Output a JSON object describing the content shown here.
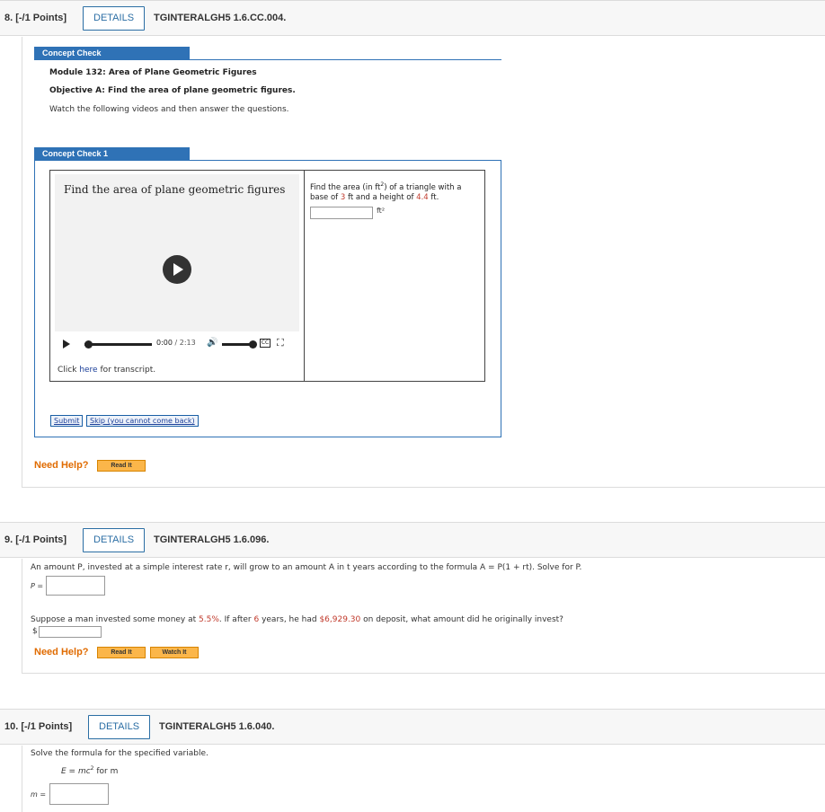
{
  "q8": {
    "number": "8.  [-/1 Points]",
    "details": "DETAILS",
    "code": "TGINTERALGH5 1.6.CC.004.",
    "concept_check_tab": "Concept Check",
    "module": "Module 132: Area of Plane Geometric Figures",
    "objective": "Objective A: Find the area of plane geometric figures.",
    "instruction": "Watch the following videos and then answer the questions.",
    "cc1_tab": "Concept Check 1",
    "video": {
      "title": "Find the area of plane geometric figures",
      "current_time": "0:00",
      "duration": "/ 2:13",
      "cc_label": "CC"
    },
    "transcript_prefix": "Click ",
    "transcript_link": "here",
    "transcript_suffix": " for transcript.",
    "prompt_a": "Find the area (in ft",
    "prompt_sup": "2",
    "prompt_b": ") of a triangle with a base of ",
    "base": "3",
    "prompt_c": " ft and a height of ",
    "height": "4.4",
    "prompt_d": " ft.",
    "unit": "ft²",
    "submit": "Submit",
    "skip": "Skip (you cannot come back)",
    "need_help": "Need Help?",
    "read_it": "Read It"
  },
  "q9": {
    "number": "9.  [-/1 Points]",
    "details": "DETAILS",
    "code": "TGINTERALGH5 1.6.096.",
    "statement": "An amount P, invested at a simple interest rate r, will grow to an amount A in t years according to the formula A = P(1 + rt). Solve for P.",
    "p_label": "P =",
    "problem_a": "Suppose a man invested some money at ",
    "rate": "5.5%",
    "problem_b": ". If after ",
    "years": "6",
    "problem_c": " years, he had ",
    "amount": "$6,929.30",
    "problem_d": " on deposit, what amount did he originally invest?",
    "dollar": "$",
    "need_help": "Need Help?",
    "read_it": "Read It",
    "watch_it": "Watch It"
  },
  "q10": {
    "number": "10.  [-/1 Points]",
    "details": "DETAILS",
    "code": "TGINTERALGH5 1.6.040.",
    "instruction": "Solve the formula for the specified variable.",
    "formula_a": "E = mc",
    "formula_sup": "2",
    "formula_b": " for m",
    "m_label": "m ="
  },
  "colors": {
    "accent_blue": "#2f72b6",
    "highlight_red": "#c0392b",
    "help_orange": "#e06b00",
    "button_orange": "#fbb64a"
  }
}
